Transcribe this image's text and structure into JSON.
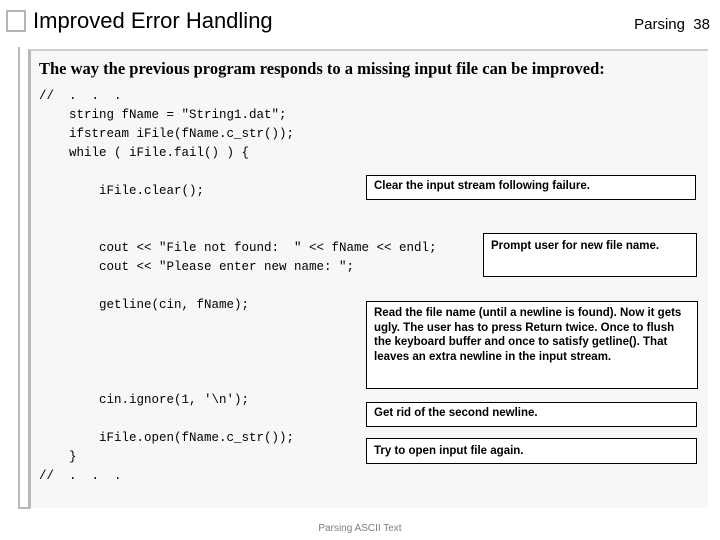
{
  "slide": {
    "title": "Improved Error Handling",
    "header_right": "Parsing  38",
    "footer": "Parsing ASCII Text",
    "lead_text": "The way the previous program responds to a missing input file can be improved:"
  },
  "code": {
    "lines": [
      "//  .  .  .",
      "    string fName = \"String1.dat\";",
      "    ifstream iFile(fName.c_str());",
      "    while ( iFile.fail() ) {",
      "",
      "        iFile.clear();",
      "",
      "",
      "        cout << \"File not found:  \" << fName << endl;",
      "        cout << \"Please enter new name: \";",
      "",
      "        getline(cin, fName);",
      "",
      "",
      "",
      "",
      "        cin.ignore(1, '\\n');",
      "",
      "        iFile.open(fName.c_str());",
      "    }",
      "//  .  .  ."
    ]
  },
  "callouts": {
    "clear_stream": "Clear the input stream following failure.",
    "prompt_user": "Prompt user for new file name.",
    "read_filename": "Read the file name (until a newline is found).  Now it gets ugly.  The user has to press Return twice.  Once to flush the keyboard buffer and once to satisfy getline().  That leaves an extra newline in the input stream.",
    "second_newline": "Get rid of the second newline.",
    "open_again": "Try to open input file again."
  },
  "colors": {
    "panel_bg": "#f7f7f7",
    "rail": "#b9b9b9",
    "footer_text": "#7d7d7d",
    "callout_bg": "#ffffff",
    "callout_border": "#000000"
  }
}
